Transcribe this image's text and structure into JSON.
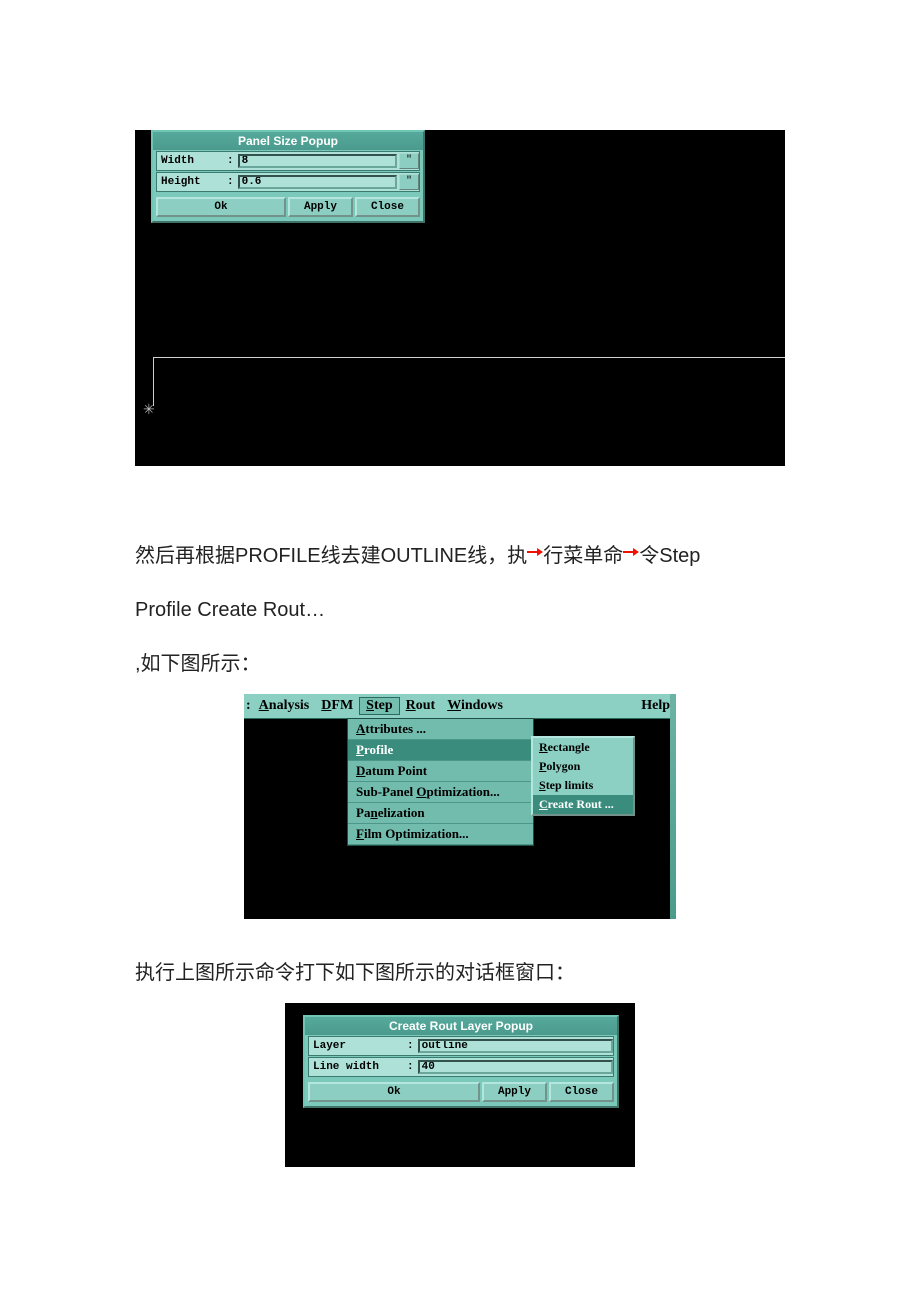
{
  "panel_size": {
    "title": "Panel Size Popup",
    "width_label": "Width",
    "width_value": "8",
    "height_label": "Height",
    "height_value": "0.6",
    "unit": "\"",
    "ok": "Ok",
    "apply": "Apply",
    "close": "Close"
  },
  "text": {
    "line1a": "然后再根据PROFILE线去建OUTLINE线，执行菜单命令Step",
    "line1b": "Profile    Create Rout…",
    "line2": ",如下图所示：",
    "line3": "执行上图所示命令打下如下图所示的对话框窗口："
  },
  "menu": {
    "bar": {
      "analysis": "Analysis",
      "dfm": "DFM",
      "step": "Step",
      "rout": "Rout",
      "windows": "Windows",
      "help": "Help"
    },
    "step_items": {
      "attributes": "Attributes ...",
      "profile": "Profile",
      "datum": "Datum Point",
      "subpanel": "Sub-Panel Optimization...",
      "panelization": "Panelization",
      "film": "Film Optimization..."
    },
    "profile_sub": {
      "rectangle": "Rectangle",
      "polygon": "Polygon",
      "step_limits": "Step limits",
      "create_rout": "Create Rout ..."
    }
  },
  "rout_layer": {
    "title": "Create Rout Layer Popup",
    "layer_label": "Layer",
    "layer_value": "outline",
    "width_label": "Line width",
    "width_value": "40",
    "ok": "Ok",
    "apply": "Apply",
    "close": "Close"
  }
}
